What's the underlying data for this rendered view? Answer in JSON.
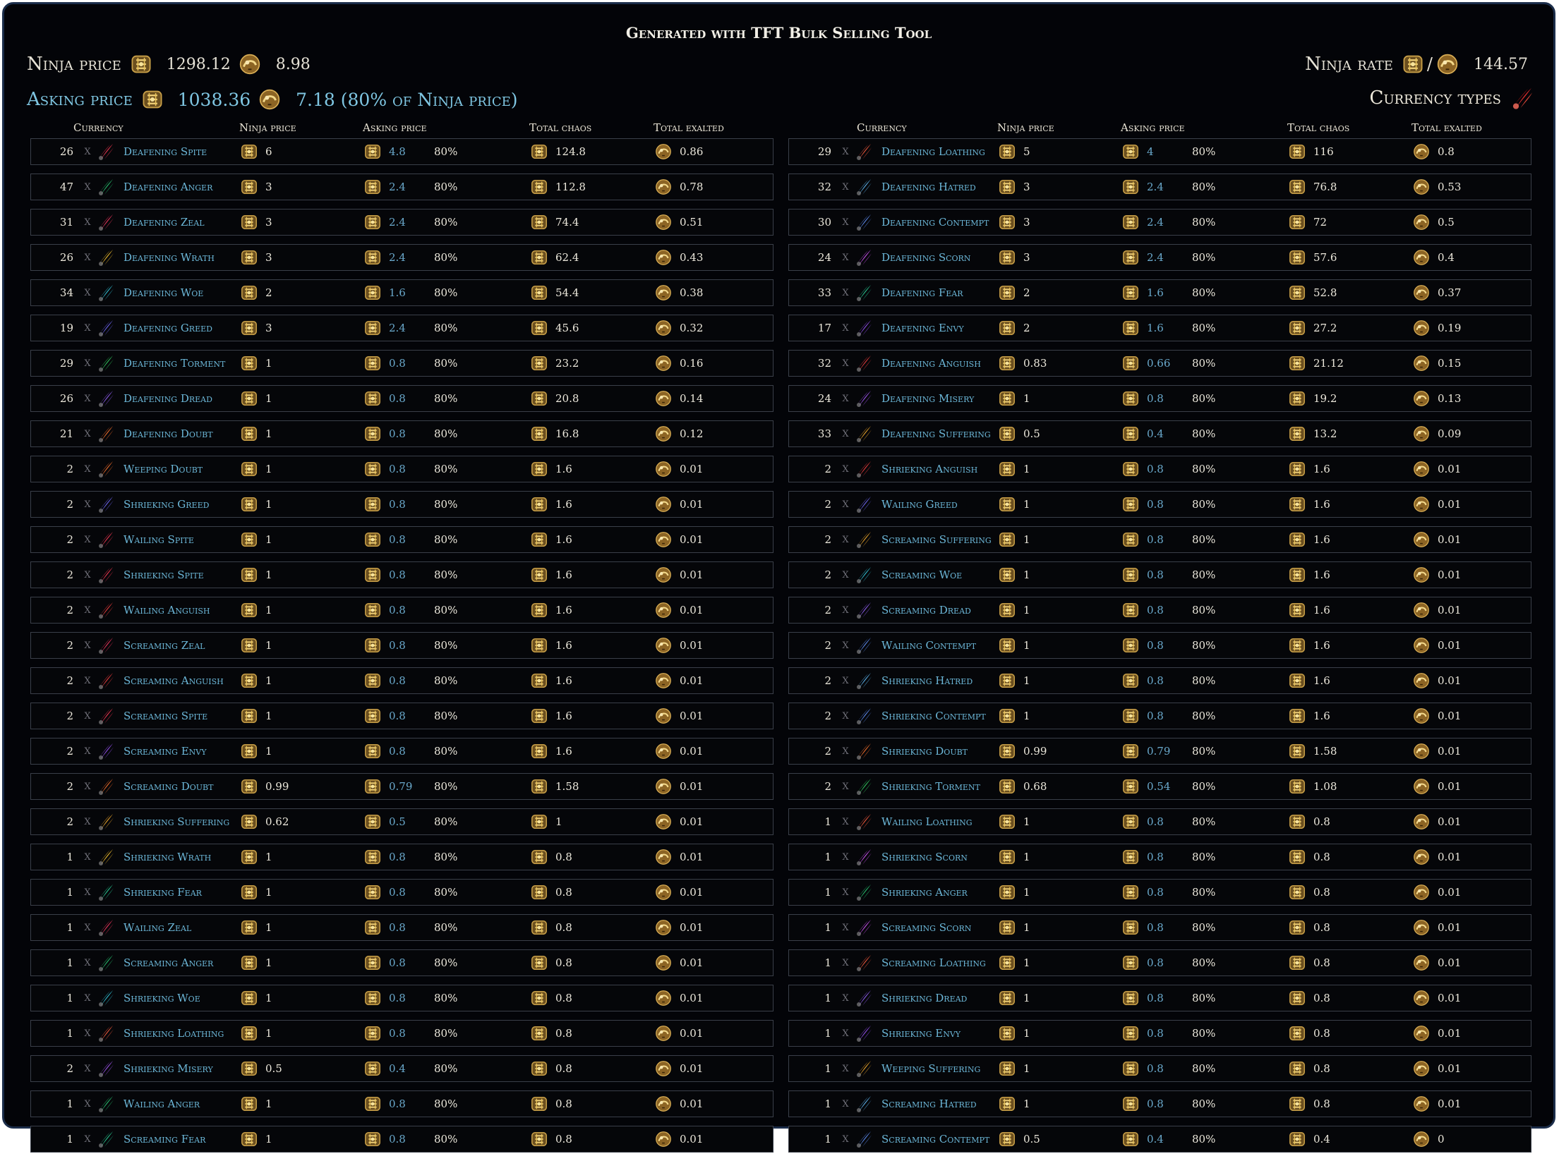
{
  "title": "Generated with TFT Bulk Selling Tool",
  "summary": {
    "ninja_price_label": "Ninja price",
    "ninja_price_chaos": "1298.12",
    "ninja_price_exalted": "8.98",
    "asking_price_label": "Asking price",
    "asking_price_chaos": "1038.36",
    "asking_price_exalted": "7.18 (80% of Ninja price)",
    "ninja_rate_label": "Ninja rate",
    "ninja_rate_separator": "/",
    "ninja_rate_value": "144.57",
    "currency_types_label": "Currency types"
  },
  "columns": {
    "currency": "Currency",
    "ninja_price": "Ninja price",
    "asking_price": "Asking price",
    "total_chaos": "Total chaos",
    "total_exalted": "Total exalted"
  },
  "multiply_symbol": "X",
  "icons": {
    "chaos": "chaos-orb-icon",
    "exalted": "exalted-orb-icon",
    "essence": "essence-icon",
    "currency_types": "essence-red-icon"
  },
  "essence_colors": {
    "Spite": "#e8354f",
    "Anger": "#25b86a",
    "Zeal": "#e4345a",
    "Wrath": "#e9b82b",
    "Woe": "#30b9cc",
    "Greed": "#6a62e8",
    "Torment": "#2fbf5a",
    "Dread": "#8a5ae6",
    "Doubt": "#e86a2a",
    "Loathing": "#e8553a",
    "Hatred": "#5aaee6",
    "Contempt": "#5a86e6",
    "Scorn": "#c24ee6",
    "Fear": "#27c08c",
    "Envy": "#8d4be3",
    "Anguish": "#e23a3a",
    "Misery": "#9a52e6",
    "Suffering": "#e5a12a"
  },
  "left_rows": [
    {
      "qty": "26",
      "name": "Deafening Spite",
      "ninja": "6",
      "ask": "4.8",
      "pct": "80%",
      "chaos": "124.8",
      "exalted": "0.86"
    },
    {
      "qty": "47",
      "name": "Deafening Anger",
      "ninja": "3",
      "ask": "2.4",
      "pct": "80%",
      "chaos": "112.8",
      "exalted": "0.78"
    },
    {
      "qty": "31",
      "name": "Deafening Zeal",
      "ninja": "3",
      "ask": "2.4",
      "pct": "80%",
      "chaos": "74.4",
      "exalted": "0.51"
    },
    {
      "qty": "26",
      "name": "Deafening Wrath",
      "ninja": "3",
      "ask": "2.4",
      "pct": "80%",
      "chaos": "62.4",
      "exalted": "0.43"
    },
    {
      "qty": "34",
      "name": "Deafening Woe",
      "ninja": "2",
      "ask": "1.6",
      "pct": "80%",
      "chaos": "54.4",
      "exalted": "0.38"
    },
    {
      "qty": "19",
      "name": "Deafening Greed",
      "ninja": "3",
      "ask": "2.4",
      "pct": "80%",
      "chaos": "45.6",
      "exalted": "0.32"
    },
    {
      "qty": "29",
      "name": "Deafening Torment",
      "ninja": "1",
      "ask": "0.8",
      "pct": "80%",
      "chaos": "23.2",
      "exalted": "0.16"
    },
    {
      "qty": "26",
      "name": "Deafening Dread",
      "ninja": "1",
      "ask": "0.8",
      "pct": "80%",
      "chaos": "20.8",
      "exalted": "0.14"
    },
    {
      "qty": "21",
      "name": "Deafening Doubt",
      "ninja": "1",
      "ask": "0.8",
      "pct": "80%",
      "chaos": "16.8",
      "exalted": "0.12"
    },
    {
      "qty": "2",
      "name": "Weeping Doubt",
      "ninja": "1",
      "ask": "0.8",
      "pct": "80%",
      "chaos": "1.6",
      "exalted": "0.01"
    },
    {
      "qty": "2",
      "name": "Shrieking Greed",
      "ninja": "1",
      "ask": "0.8",
      "pct": "80%",
      "chaos": "1.6",
      "exalted": "0.01"
    },
    {
      "qty": "2",
      "name": "Wailing Spite",
      "ninja": "1",
      "ask": "0.8",
      "pct": "80%",
      "chaos": "1.6",
      "exalted": "0.01"
    },
    {
      "qty": "2",
      "name": "Shrieking Spite",
      "ninja": "1",
      "ask": "0.8",
      "pct": "80%",
      "chaos": "1.6",
      "exalted": "0.01"
    },
    {
      "qty": "2",
      "name": "Wailing Anguish",
      "ninja": "1",
      "ask": "0.8",
      "pct": "80%",
      "chaos": "1.6",
      "exalted": "0.01"
    },
    {
      "qty": "2",
      "name": "Screaming Zeal",
      "ninja": "1",
      "ask": "0.8",
      "pct": "80%",
      "chaos": "1.6",
      "exalted": "0.01"
    },
    {
      "qty": "2",
      "name": "Screaming Anguish",
      "ninja": "1",
      "ask": "0.8",
      "pct": "80%",
      "chaos": "1.6",
      "exalted": "0.01"
    },
    {
      "qty": "2",
      "name": "Screaming Spite",
      "ninja": "1",
      "ask": "0.8",
      "pct": "80%",
      "chaos": "1.6",
      "exalted": "0.01"
    },
    {
      "qty": "2",
      "name": "Screaming Envy",
      "ninja": "1",
      "ask": "0.8",
      "pct": "80%",
      "chaos": "1.6",
      "exalted": "0.01"
    },
    {
      "qty": "2",
      "name": "Screaming Doubt",
      "ninja": "0.99",
      "ask": "0.79",
      "pct": "80%",
      "chaos": "1.58",
      "exalted": "0.01"
    },
    {
      "qty": "2",
      "name": "Shrieking Suffering",
      "ninja": "0.62",
      "ask": "0.5",
      "pct": "80%",
      "chaos": "1",
      "exalted": "0.01"
    },
    {
      "qty": "1",
      "name": "Shrieking Wrath",
      "ninja": "1",
      "ask": "0.8",
      "pct": "80%",
      "chaos": "0.8",
      "exalted": "0.01"
    },
    {
      "qty": "1",
      "name": "Shrieking Fear",
      "ninja": "1",
      "ask": "0.8",
      "pct": "80%",
      "chaos": "0.8",
      "exalted": "0.01"
    },
    {
      "qty": "1",
      "name": "Wailing Zeal",
      "ninja": "1",
      "ask": "0.8",
      "pct": "80%",
      "chaos": "0.8",
      "exalted": "0.01"
    },
    {
      "qty": "1",
      "name": "Screaming Anger",
      "ninja": "1",
      "ask": "0.8",
      "pct": "80%",
      "chaos": "0.8",
      "exalted": "0.01"
    },
    {
      "qty": "1",
      "name": "Shrieking Woe",
      "ninja": "1",
      "ask": "0.8",
      "pct": "80%",
      "chaos": "0.8",
      "exalted": "0.01"
    },
    {
      "qty": "1",
      "name": "Shrieking Loathing",
      "ninja": "1",
      "ask": "0.8",
      "pct": "80%",
      "chaos": "0.8",
      "exalted": "0.01"
    },
    {
      "qty": "2",
      "name": "Shrieking Misery",
      "ninja": "0.5",
      "ask": "0.4",
      "pct": "80%",
      "chaos": "0.8",
      "exalted": "0.01"
    },
    {
      "qty": "1",
      "name": "Wailing Anger",
      "ninja": "1",
      "ask": "0.8",
      "pct": "80%",
      "chaos": "0.8",
      "exalted": "0.01"
    },
    {
      "qty": "1",
      "name": "Screaming Fear",
      "ninja": "1",
      "ask": "0.8",
      "pct": "80%",
      "chaos": "0.8",
      "exalted": "0.01"
    }
  ],
  "right_rows": [
    {
      "qty": "29",
      "name": "Deafening Loathing",
      "ninja": "5",
      "ask": "4",
      "pct": "80%",
      "chaos": "116",
      "exalted": "0.8"
    },
    {
      "qty": "32",
      "name": "Deafening Hatred",
      "ninja": "3",
      "ask": "2.4",
      "pct": "80%",
      "chaos": "76.8",
      "exalted": "0.53"
    },
    {
      "qty": "30",
      "name": "Deafening Contempt",
      "ninja": "3",
      "ask": "2.4",
      "pct": "80%",
      "chaos": "72",
      "exalted": "0.5"
    },
    {
      "qty": "24",
      "name": "Deafening Scorn",
      "ninja": "3",
      "ask": "2.4",
      "pct": "80%",
      "chaos": "57.6",
      "exalted": "0.4"
    },
    {
      "qty": "33",
      "name": "Deafening Fear",
      "ninja": "2",
      "ask": "1.6",
      "pct": "80%",
      "chaos": "52.8",
      "exalted": "0.37"
    },
    {
      "qty": "17",
      "name": "Deafening Envy",
      "ninja": "2",
      "ask": "1.6",
      "pct": "80%",
      "chaos": "27.2",
      "exalted": "0.19"
    },
    {
      "qty": "32",
      "name": "Deafening Anguish",
      "ninja": "0.83",
      "ask": "0.66",
      "pct": "80%",
      "chaos": "21.12",
      "exalted": "0.15"
    },
    {
      "qty": "24",
      "name": "Deafening Misery",
      "ninja": "1",
      "ask": "0.8",
      "pct": "80%",
      "chaos": "19.2",
      "exalted": "0.13"
    },
    {
      "qty": "33",
      "name": "Deafening Suffering",
      "ninja": "0.5",
      "ask": "0.4",
      "pct": "80%",
      "chaos": "13.2",
      "exalted": "0.09"
    },
    {
      "qty": "2",
      "name": "Shrieking Anguish",
      "ninja": "1",
      "ask": "0.8",
      "pct": "80%",
      "chaos": "1.6",
      "exalted": "0.01"
    },
    {
      "qty": "2",
      "name": "Wailing Greed",
      "ninja": "1",
      "ask": "0.8",
      "pct": "80%",
      "chaos": "1.6",
      "exalted": "0.01"
    },
    {
      "qty": "2",
      "name": "Screaming Suffering",
      "ninja": "1",
      "ask": "0.8",
      "pct": "80%",
      "chaos": "1.6",
      "exalted": "0.01"
    },
    {
      "qty": "2",
      "name": "Screaming Woe",
      "ninja": "1",
      "ask": "0.8",
      "pct": "80%",
      "chaos": "1.6",
      "exalted": "0.01"
    },
    {
      "qty": "2",
      "name": "Screaming Dread",
      "ninja": "1",
      "ask": "0.8",
      "pct": "80%",
      "chaos": "1.6",
      "exalted": "0.01"
    },
    {
      "qty": "2",
      "name": "Wailing Contempt",
      "ninja": "1",
      "ask": "0.8",
      "pct": "80%",
      "chaos": "1.6",
      "exalted": "0.01"
    },
    {
      "qty": "2",
      "name": "Shrieking Hatred",
      "ninja": "1",
      "ask": "0.8",
      "pct": "80%",
      "chaos": "1.6",
      "exalted": "0.01"
    },
    {
      "qty": "2",
      "name": "Shrieking Contempt",
      "ninja": "1",
      "ask": "0.8",
      "pct": "80%",
      "chaos": "1.6",
      "exalted": "0.01"
    },
    {
      "qty": "2",
      "name": "Shrieking Doubt",
      "ninja": "0.99",
      "ask": "0.79",
      "pct": "80%",
      "chaos": "1.58",
      "exalted": "0.01"
    },
    {
      "qty": "2",
      "name": "Shrieking Torment",
      "ninja": "0.68",
      "ask": "0.54",
      "pct": "80%",
      "chaos": "1.08",
      "exalted": "0.01"
    },
    {
      "qty": "1",
      "name": "Wailing Loathing",
      "ninja": "1",
      "ask": "0.8",
      "pct": "80%",
      "chaos": "0.8",
      "exalted": "0.01"
    },
    {
      "qty": "1",
      "name": "Shrieking Scorn",
      "ninja": "1",
      "ask": "0.8",
      "pct": "80%",
      "chaos": "0.8",
      "exalted": "0.01"
    },
    {
      "qty": "1",
      "name": "Shrieking Anger",
      "ninja": "1",
      "ask": "0.8",
      "pct": "80%",
      "chaos": "0.8",
      "exalted": "0.01"
    },
    {
      "qty": "1",
      "name": "Screaming Scorn",
      "ninja": "1",
      "ask": "0.8",
      "pct": "80%",
      "chaos": "0.8",
      "exalted": "0.01"
    },
    {
      "qty": "1",
      "name": "Screaming Loathing",
      "ninja": "1",
      "ask": "0.8",
      "pct": "80%",
      "chaos": "0.8",
      "exalted": "0.01"
    },
    {
      "qty": "1",
      "name": "Shrieking Dread",
      "ninja": "1",
      "ask": "0.8",
      "pct": "80%",
      "chaos": "0.8",
      "exalted": "0.01"
    },
    {
      "qty": "1",
      "name": "Shrieking Envy",
      "ninja": "1",
      "ask": "0.8",
      "pct": "80%",
      "chaos": "0.8",
      "exalted": "0.01"
    },
    {
      "qty": "1",
      "name": "Weeping Suffering",
      "ninja": "1",
      "ask": "0.8",
      "pct": "80%",
      "chaos": "0.8",
      "exalted": "0.01"
    },
    {
      "qty": "1",
      "name": "Screaming Hatred",
      "ninja": "1",
      "ask": "0.8",
      "pct": "80%",
      "chaos": "0.8",
      "exalted": "0.01"
    },
    {
      "qty": "1",
      "name": "Screaming Contempt",
      "ninja": "0.5",
      "ask": "0.4",
      "pct": "80%",
      "chaos": "0.4",
      "exalted": "0"
    }
  ]
}
